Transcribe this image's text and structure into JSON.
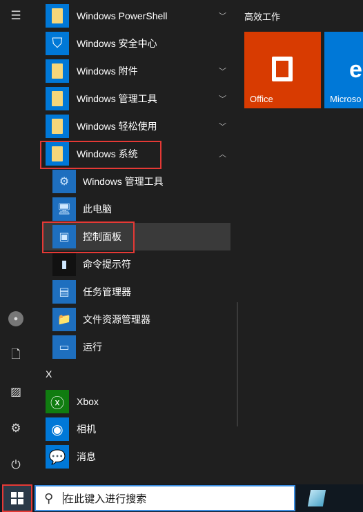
{
  "rail": {
    "icons": [
      "hamburger-menu-icon",
      "user-icon",
      "document-icon",
      "pictures-icon",
      "settings-icon",
      "power-icon"
    ]
  },
  "apps": [
    {
      "label": "Windows PowerShell",
      "icon": "folder",
      "expand": "collapsed"
    },
    {
      "label": "Windows 安全中心",
      "icon": "shield"
    },
    {
      "label": "Windows 附件",
      "icon": "folder",
      "expand": "collapsed"
    },
    {
      "label": "Windows 管理工具",
      "icon": "folder",
      "expand": "collapsed"
    },
    {
      "label": "Windows 轻松使用",
      "icon": "folder",
      "expand": "collapsed"
    },
    {
      "label": "Windows 系统",
      "icon": "folder",
      "expand": "expanded"
    }
  ],
  "sub_items": [
    {
      "label": "Windows 管理工具"
    },
    {
      "label": "此电脑"
    },
    {
      "label": "控制面板"
    },
    {
      "label": "命令提示符"
    },
    {
      "label": "任务管理器"
    },
    {
      "label": "文件资源管理器"
    },
    {
      "label": "运行"
    }
  ],
  "section_x": "X",
  "x_apps": [
    {
      "label": "Xbox",
      "color": "#107c10"
    },
    {
      "label": "相机",
      "color": "#0078d7"
    },
    {
      "label": "消息",
      "color": "#0078d7"
    }
  ],
  "tiles": {
    "group_title": "高效工作",
    "items": [
      {
        "label": "Office",
        "color": "#d83b01"
      },
      {
        "label": "Microso",
        "color": "#0078d7"
      }
    ]
  },
  "search": {
    "placeholder": "在此键入进行搜索"
  },
  "colors": {
    "accent": "#0078d7",
    "highlight": "#e53935"
  }
}
